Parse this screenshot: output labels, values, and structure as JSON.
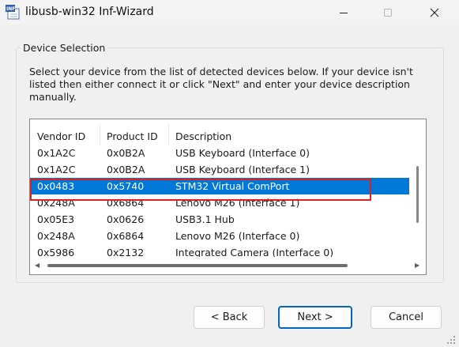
{
  "window": {
    "title": "libusb-win32 Inf-Wizard",
    "icon_label": "INF",
    "minimize_icon": "minimize-icon",
    "maximize_icon": "maximize-icon",
    "close_icon": "close-icon"
  },
  "device_selection": {
    "group_label": "Device Selection",
    "instructions": "Select your device from the list of detected devices below. If your device isn't listed then either connect it or click \"Next\" and enter your device description manually.",
    "columns": [
      "Vendor ID",
      "Product ID",
      "Description"
    ],
    "rows": [
      {
        "vendor_id": "0x1A2C",
        "product_id": "0x0B2A",
        "description": "USB Keyboard (Interface 0)"
      },
      {
        "vendor_id": "0x1A2C",
        "product_id": "0x0B2A",
        "description": "USB Keyboard (Interface 1)"
      },
      {
        "vendor_id": "0x0483",
        "product_id": "0x5740",
        "description": "STM32 Virtual ComPort"
      },
      {
        "vendor_id": "0x248A",
        "product_id": "0x6864",
        "description": "Lenovo M26 (Interface 1)"
      },
      {
        "vendor_id": "0x05E3",
        "product_id": "0x0626",
        "description": "USB3.1 Hub"
      },
      {
        "vendor_id": "0x248A",
        "product_id": "0x6864",
        "description": "Lenovo M26 (Interface 0)"
      },
      {
        "vendor_id": "0x5986",
        "product_id": "0x2132",
        "description": "Integrated Camera (Interface 0)"
      }
    ],
    "selected_row": 2,
    "selection_color": "#0078d7",
    "annotation_color": "#e02020"
  },
  "buttons": {
    "back": "< Back",
    "next": "Next >",
    "cancel": "Cancel"
  },
  "colors": {
    "accent": "#0067c0"
  }
}
